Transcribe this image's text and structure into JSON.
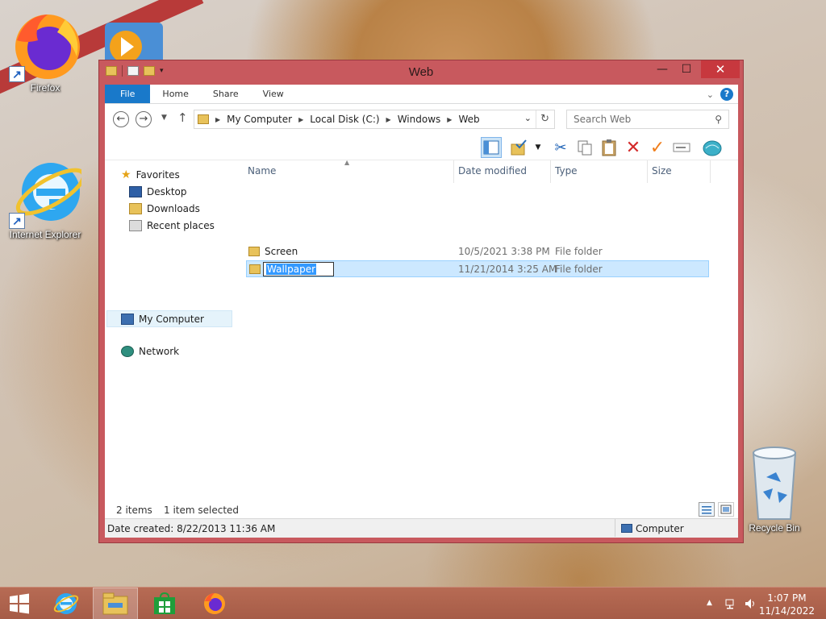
{
  "desktop": {
    "icons": [
      {
        "label": "Firefox"
      },
      {
        "label": "Internet Explorer"
      },
      {
        "label": "Recycle Bin"
      }
    ]
  },
  "window": {
    "title": "Web",
    "ribbon_tabs": [
      "File",
      "Home",
      "Share",
      "View"
    ],
    "breadcrumb": [
      "My Computer",
      "Local Disk (C:)",
      "Windows",
      "Web"
    ],
    "search_placeholder": "Search Web"
  },
  "navigation": {
    "favorites": "Favorites",
    "favorites_items": [
      "Desktop",
      "Downloads",
      "Recent places"
    ],
    "computer": "My Computer",
    "network": "Network"
  },
  "file_list": {
    "columns": [
      "Name",
      "Date modified",
      "Type",
      "Size"
    ],
    "rows": [
      {
        "name": "Screen",
        "date": "10/5/2021 3:38 PM",
        "type": "File folder",
        "size": ""
      },
      {
        "name": "Wallpaper",
        "date": "11/21/2014 3:25 AM",
        "type": "File folder",
        "size": "",
        "selected": true
      }
    ]
  },
  "status": {
    "items_count": "2 items",
    "selection": "1 item selected",
    "detail": "Date created: 8/22/2013 11:36 AM",
    "location": "Computer"
  },
  "taskbar": {
    "time": "1:07 PM",
    "date": "11/14/2022"
  },
  "colors": {
    "window_frame": "#c8595e",
    "accent": "#1979ca",
    "selection": "#cce8ff",
    "taskbar": "#a65c47"
  }
}
